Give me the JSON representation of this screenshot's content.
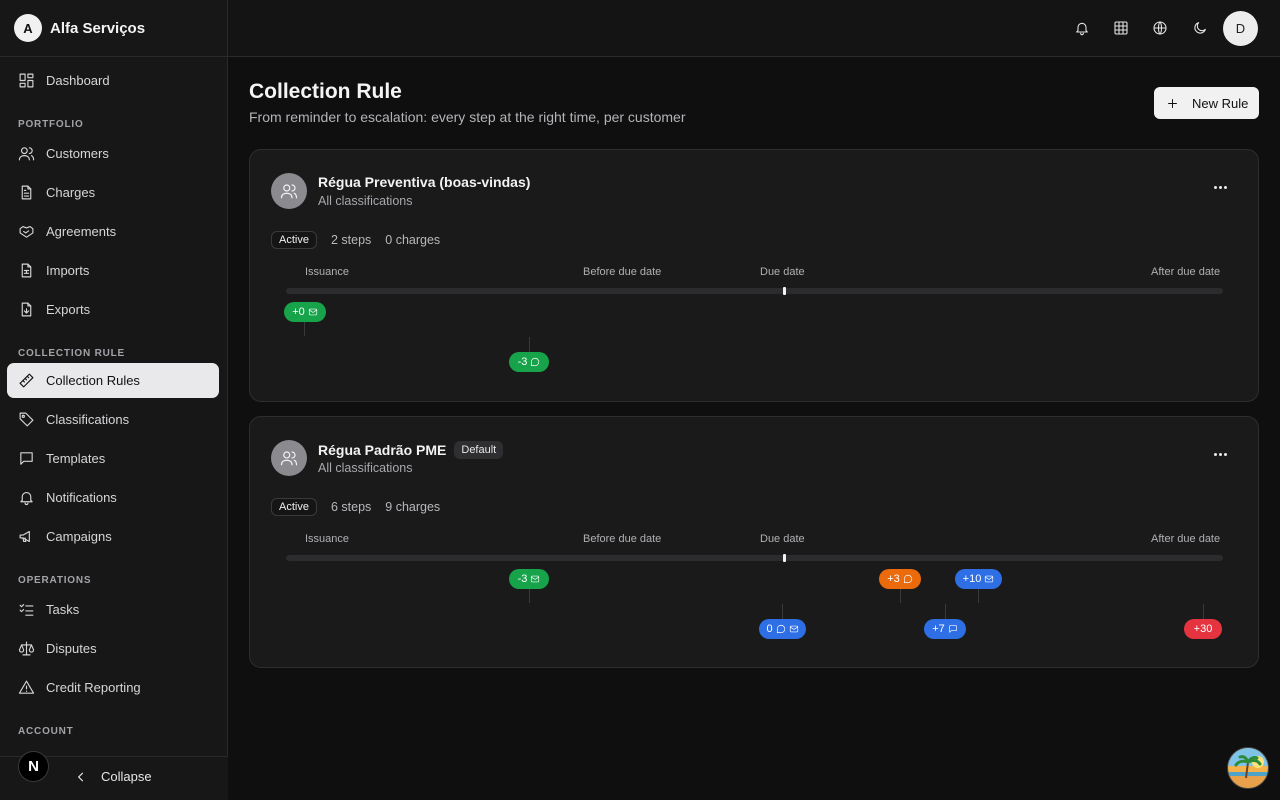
{
  "brand": {
    "initial": "A",
    "name": "Alfa Serviços"
  },
  "sidebar": {
    "dashboard": "Dashboard",
    "sections": {
      "portfolio": "PORTFOLIO",
      "collection_rule": "COLLECTION RULE",
      "operations": "OPERATIONS",
      "account": "ACCOUNT"
    },
    "items": {
      "customers": "Customers",
      "charges": "Charges",
      "agreements": "Agreements",
      "imports": "Imports",
      "exports": "Exports",
      "collection_rules": "Collection Rules",
      "classifications": "Classifications",
      "templates": "Templates",
      "notifications": "Notifications",
      "campaigns": "Campaigns",
      "tasks": "Tasks",
      "disputes": "Disputes",
      "credit_reporting": "Credit Reporting"
    },
    "active": "collection_rules",
    "collapse_label": "Collapse",
    "badge": "N"
  },
  "topbar": {
    "icons": [
      "bell-icon",
      "grid-icon",
      "globe-icon",
      "moon-icon"
    ],
    "user_initial": "D"
  },
  "page": {
    "title": "Collection Rule",
    "subtitle": "From reminder to escalation: every step at the right time, per customer",
    "new_rule_label": "New Rule"
  },
  "timeline_labels": {
    "issuance": "Issuance",
    "before_due": "Before due date",
    "due": "Due date",
    "after_due": "After due date"
  },
  "rules": [
    {
      "name": "Régua Preventiva (boas-vindas)",
      "is_default": false,
      "classification": "All classifications",
      "status": "Active",
      "steps": "2 steps",
      "charges": "0 charges",
      "markers": [
        {
          "label": "+0",
          "color": "green",
          "channels": [
            "mail"
          ]
        },
        {
          "label": "-3",
          "color": "green",
          "channels": [
            "chat"
          ]
        }
      ]
    },
    {
      "name": "Régua Padrão PME",
      "is_default": true,
      "default_label": "Default",
      "classification": "All classifications",
      "status": "Active",
      "steps": "6 steps",
      "charges": "9 charges",
      "markers": [
        {
          "label": "-3",
          "color": "green",
          "channels": [
            "mail"
          ]
        },
        {
          "label": "+3",
          "color": "orange",
          "channels": [
            "chat"
          ]
        },
        {
          "label": "+10",
          "color": "blue",
          "channels": [
            "mail"
          ]
        },
        {
          "label": "0",
          "color": "blue",
          "channels": [
            "chat",
            "mail"
          ]
        },
        {
          "label": "+7",
          "color": "blue",
          "channels": [
            "message"
          ]
        },
        {
          "label": "+30",
          "color": "red",
          "channels": []
        }
      ]
    }
  ],
  "colors": {
    "green": "#16a34a",
    "orange": "#ea6a0c",
    "blue": "#2f6fe6",
    "red": "#e5343f"
  }
}
